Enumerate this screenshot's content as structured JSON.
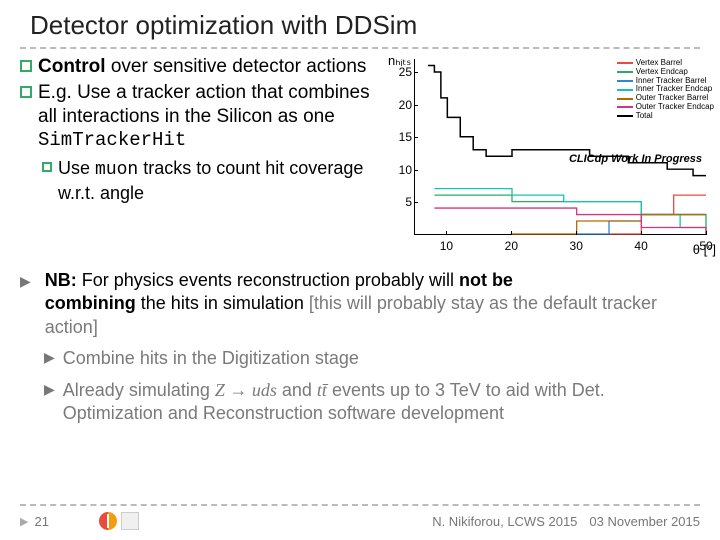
{
  "title": "Detector optimization with DDSim",
  "bullets": {
    "b1_lead": "Control",
    "b1_rest": " over sensitive detector actions",
    "b2_pre": "E.g. Use a tracker action that combines all interactions in the Silicon as one ",
    "b2_mono": "SimTrackerHit",
    "sub_pre": "Use ",
    "sub_mono": "muon",
    "sub_post": " tracks to count hit coverage w.r.t. angle"
  },
  "nb": {
    "line1a": "NB:",
    "line1b": " For physics events reconstruction probably will ",
    "line1c": "not be",
    "line2a": "combining",
    "line2b": " the hits in simulation",
    "line2c": " [this will probably stay as the default tracker action]",
    "indent1": "Combine hits in the Digitization stage",
    "indent2a": "Already simulating ",
    "indent2_m1": "Z → uds",
    "indent2b": " and ",
    "indent2_m2": "tt̄",
    "indent2c": " events up to 3 TeV to aid with Det. Optimization and Reconstruction software development"
  },
  "chart_data": {
    "type": "line",
    "xlabel": "θ [°]",
    "ylabel": "nₕᵢₜₛ",
    "xlim": [
      5,
      50
    ],
    "ylim": [
      0,
      27
    ],
    "xticks": [
      10,
      20,
      30,
      40,
      50
    ],
    "yticks": [
      5,
      10,
      15,
      20,
      25
    ],
    "wip_label": "CLICdp Work In Progress",
    "series": [
      {
        "name": "Vertex Barrel",
        "color": "#e74c3c"
      },
      {
        "name": "Vertex Endcap",
        "color": "#27ae60"
      },
      {
        "name": "Inner Tracker Barrel",
        "color": "#2e86de"
      },
      {
        "name": "Inner Tracker Endcap",
        "color": "#17c3b2"
      },
      {
        "name": "Outer Tracker Barrel",
        "color": "#b36b00"
      },
      {
        "name": "Outer Tracker Endcap",
        "color": "#d63384"
      },
      {
        "name": "Total",
        "color": "#000000"
      }
    ],
    "total_step": {
      "x": [
        7,
        8,
        9,
        10,
        12,
        14,
        16,
        18,
        20,
        22,
        24,
        26,
        28,
        30,
        32,
        35,
        38,
        40,
        42,
        44,
        46,
        48,
        50
      ],
      "y": [
        26,
        25,
        21,
        18,
        15,
        13,
        12,
        12,
        13,
        13,
        13,
        13,
        13,
        13,
        12,
        12,
        11,
        11,
        11,
        10,
        10,
        9,
        9
      ]
    },
    "low_series_example": {
      "vertex_barrel": {
        "x": [
          35,
          40,
          45,
          50
        ],
        "y": [
          0,
          3,
          6,
          6
        ]
      },
      "vertex_endcap": {
        "x": [
          8,
          12,
          20,
          30,
          40,
          50
        ],
        "y": [
          6,
          6,
          5,
          5,
          3,
          0
        ]
      },
      "it_barrel": {
        "x": [
          30,
          35,
          40,
          45,
          50
        ],
        "y": [
          0,
          2,
          3,
          3,
          3
        ]
      },
      "it_endcap": {
        "x": [
          8,
          12,
          20,
          28,
          40,
          46,
          50
        ],
        "y": [
          7,
          7,
          6,
          5,
          3,
          1,
          0
        ]
      },
      "ot_barrel": {
        "x": [
          20,
          30,
          40,
          50
        ],
        "y": [
          0,
          2,
          3,
          3
        ]
      },
      "ot_endcap": {
        "x": [
          8,
          14,
          20,
          30,
          40,
          50
        ],
        "y": [
          4,
          4,
          4,
          3,
          1,
          0
        ]
      }
    }
  },
  "footer": {
    "page": "21",
    "center": "N. Nikiforou, LCWS 2015",
    "date": "03 November 2015"
  }
}
